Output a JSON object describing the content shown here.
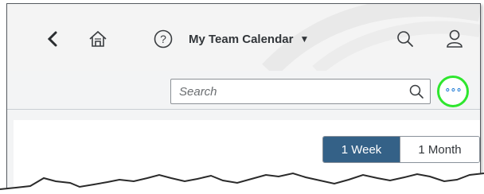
{
  "shellbar": {
    "back_icon": "chevron-left-icon",
    "home_icon": "home-icon",
    "help_icon": "help-circle-icon",
    "title": "My Team Calendar",
    "title_caret": "▼",
    "search_icon": "search-icon",
    "user_icon": "user-icon"
  },
  "toolbar": {
    "search_placeholder": "Search",
    "overflow_icon": "overflow-dots-icon",
    "overflow_glyph": "∘∘∘"
  },
  "view_switch": {
    "week_label": "1 Week",
    "month_label": "1 Month",
    "selected": "1 Week"
  },
  "colors": {
    "accent": "#346187",
    "icon_blue": "#0a6ed1",
    "highlight_ring": "#2ee62e"
  }
}
